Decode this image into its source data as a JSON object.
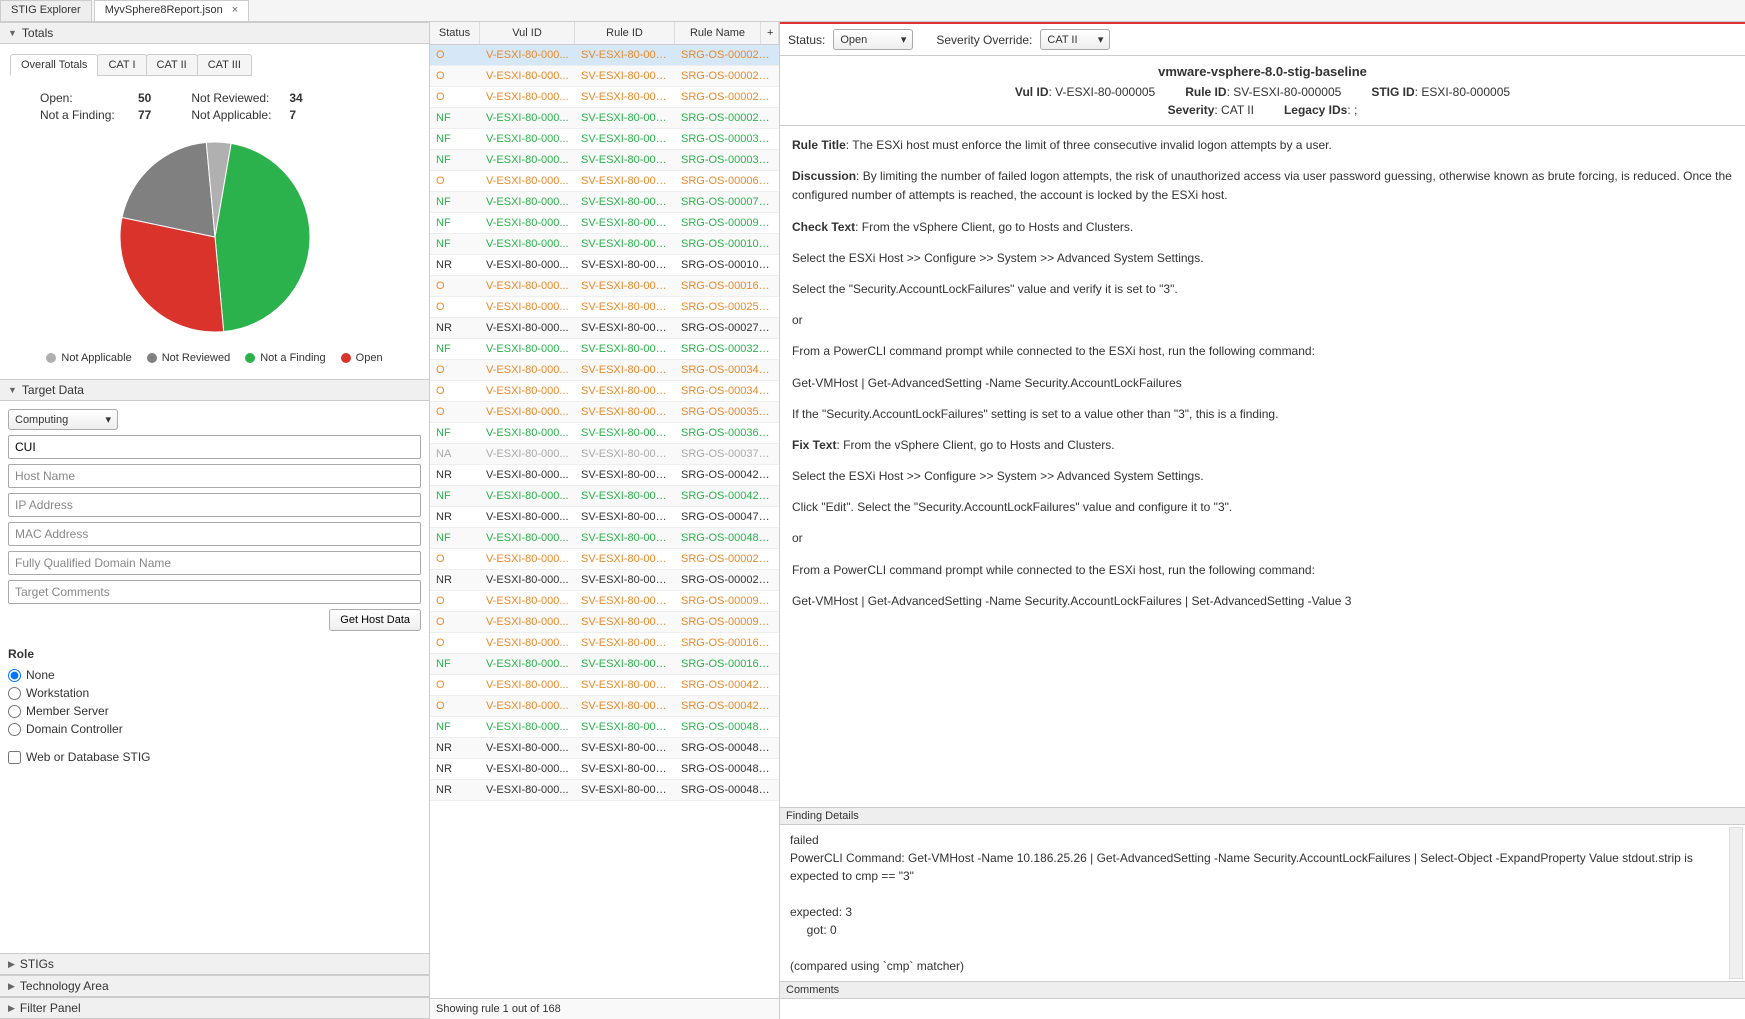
{
  "tabs": {
    "explorer": "STIG Explorer",
    "file": "MyvSphere8Report.json",
    "close_glyph": "×"
  },
  "left": {
    "totals_header": "Totals",
    "sub_tabs": [
      "Overall Totals",
      "CAT I",
      "CAT II",
      "CAT III"
    ],
    "stats": {
      "open_label": "Open:",
      "open_val": "50",
      "nf_label": "Not a Finding:",
      "nf_val": "77",
      "nr_label": "Not Reviewed:",
      "nr_val": "34",
      "na_label": "Not Applicable:",
      "na_val": "7"
    },
    "legend": {
      "na": "Not Applicable",
      "nr": "Not Reviewed",
      "nf": "Not a Finding",
      "open": "Open"
    },
    "target_header": "Target Data",
    "computing": "Computing",
    "cui": "CUI",
    "placeholders": {
      "host": "Host Name",
      "ip": "IP Address",
      "mac": "MAC Address",
      "fqdn": "Fully Qualified Domain Name",
      "comments": "Target Comments"
    },
    "get_host_btn": "Get Host Data",
    "role_title": "Role",
    "roles": {
      "none": "None",
      "ws": "Workstation",
      "ms": "Member Server",
      "dc": "Domain Controller"
    },
    "web_db": "Web or Database STIG",
    "collapsed": {
      "stigs": "STIGs",
      "tech": "Technology Area",
      "filter": "Filter Panel"
    }
  },
  "chart_data": {
    "type": "pie",
    "title": "",
    "series": [
      {
        "name": "Not a Finding",
        "value": 77,
        "color": "#2bb24c"
      },
      {
        "name": "Open",
        "value": 50,
        "color": "#d9332c"
      },
      {
        "name": "Not Reviewed",
        "value": 34,
        "color": "#808080"
      },
      {
        "name": "Not Applicable",
        "value": 7,
        "color": "#b0b0b0"
      }
    ]
  },
  "grid": {
    "headers": {
      "status": "Status",
      "vul": "Vul ID",
      "rule": "Rule ID",
      "name": "Rule Name",
      "plus": "+"
    },
    "footer": "Showing rule 1 out of 168",
    "rows": [
      {
        "s": "O",
        "v": "V-ESXI-80-000...",
        "r": "SV-ESXI-80-000...",
        "n": "SRG-OS-000021-...",
        "sel": true
      },
      {
        "s": "O",
        "v": "V-ESXI-80-000...",
        "r": "SV-ESXI-80-000...",
        "n": "SRG-OS-000023-..."
      },
      {
        "s": "O",
        "v": "V-ESXI-80-000...",
        "r": "SV-ESXI-80-000...",
        "n": "SRG-OS-000027-..."
      },
      {
        "s": "NF",
        "v": "V-ESXI-80-000...",
        "r": "SV-ESXI-80-000...",
        "n": "SRG-OS-000029-..."
      },
      {
        "s": "NF",
        "v": "V-ESXI-80-000...",
        "r": "SV-ESXI-80-000...",
        "n": "SRG-OS-000033-..."
      },
      {
        "s": "NF",
        "v": "V-ESXI-80-000...",
        "r": "SV-ESXI-80-000...",
        "n": "SRG-OS-000037-..."
      },
      {
        "s": "O",
        "v": "V-ESXI-80-000...",
        "r": "SV-ESXI-80-000...",
        "n": "SRG-OS-000069-..."
      },
      {
        "s": "NF",
        "v": "V-ESXI-80-000...",
        "r": "SV-ESXI-80-000...",
        "n": "SRG-OS-000077-..."
      },
      {
        "s": "NF",
        "v": "V-ESXI-80-000...",
        "r": "SV-ESXI-80-000...",
        "n": "SRG-OS-000095-..."
      },
      {
        "s": "NF",
        "v": "V-ESXI-80-000...",
        "r": "SV-ESXI-80-000...",
        "n": "SRG-OS-000104-..."
      },
      {
        "s": "NR",
        "v": "V-ESXI-80-000...",
        "r": "SV-ESXI-80-000...",
        "n": "SRG-OS-000107-..."
      },
      {
        "s": "O",
        "v": "V-ESXI-80-000...",
        "r": "SV-ESXI-80-000...",
        "n": "SRG-OS-000163-..."
      },
      {
        "s": "O",
        "v": "V-ESXI-80-000...",
        "r": "SV-ESXI-80-000...",
        "n": "SRG-OS-000257-..."
      },
      {
        "s": "NR",
        "v": "V-ESXI-80-000...",
        "r": "SV-ESXI-80-000...",
        "n": "SRG-OS-000278-..."
      },
      {
        "s": "NF",
        "v": "V-ESXI-80-000...",
        "r": "SV-ESXI-80-000...",
        "n": "SRG-OS-000329-..."
      },
      {
        "s": "O",
        "v": "V-ESXI-80-000...",
        "r": "SV-ESXI-80-000...",
        "n": "SRG-OS-000341-..."
      },
      {
        "s": "O",
        "v": "V-ESXI-80-000...",
        "r": "SV-ESXI-80-000...",
        "n": "SRG-OS-000342-..."
      },
      {
        "s": "O",
        "v": "V-ESXI-80-000...",
        "r": "SV-ESXI-80-000...",
        "n": "SRG-OS-000355-..."
      },
      {
        "s": "NF",
        "v": "V-ESXI-80-000...",
        "r": "SV-ESXI-80-000...",
        "n": "SRG-OS-000366-..."
      },
      {
        "s": "NA",
        "v": "V-ESXI-80-000...",
        "r": "SV-ESXI-80-000...",
        "n": "SRG-OS-000379-..."
      },
      {
        "s": "NR",
        "v": "V-ESXI-80-000...",
        "r": "SV-ESXI-80-000...",
        "n": "SRG-OS-000423-..."
      },
      {
        "s": "NF",
        "v": "V-ESXI-80-000...",
        "r": "SV-ESXI-80-000...",
        "n": "SRG-OS-000425-..."
      },
      {
        "s": "NR",
        "v": "V-ESXI-80-000...",
        "r": "SV-ESXI-80-000...",
        "n": "SRG-OS-000478-..."
      },
      {
        "s": "NF",
        "v": "V-ESXI-80-000...",
        "r": "SV-ESXI-80-000...",
        "n": "SRG-OS-000480-..."
      },
      {
        "s": "O",
        "v": "V-ESXI-80-000...",
        "r": "SV-ESXI-80-000...",
        "n": "SRG-OS-000023-..."
      },
      {
        "s": "NR",
        "v": "V-ESXI-80-000...",
        "r": "SV-ESXI-80-000...",
        "n": "SRG-OS-000023-..."
      },
      {
        "s": "O",
        "v": "V-ESXI-80-000...",
        "r": "SV-ESXI-80-000...",
        "n": "SRG-OS-000095-..."
      },
      {
        "s": "O",
        "v": "V-ESXI-80-000...",
        "r": "SV-ESXI-80-000...",
        "n": "SRG-OS-000095-..."
      },
      {
        "s": "O",
        "v": "V-ESXI-80-000...",
        "r": "SV-ESXI-80-000...",
        "n": "SRG-OS-000163-..."
      },
      {
        "s": "NF",
        "v": "V-ESXI-80-000...",
        "r": "SV-ESXI-80-000...",
        "n": "SRG-OS-000163-..."
      },
      {
        "s": "O",
        "v": "V-ESXI-80-000...",
        "r": "SV-ESXI-80-000...",
        "n": "SRG-OS-000423-..."
      },
      {
        "s": "O",
        "v": "V-ESXI-80-000...",
        "r": "SV-ESXI-80-000...",
        "n": "SRG-OS-000423-..."
      },
      {
        "s": "NF",
        "v": "V-ESXI-80-000...",
        "r": "SV-ESXI-80-000...",
        "n": "SRG-OS-000480-..."
      },
      {
        "s": "NR",
        "v": "V-ESXI-80-000...",
        "r": "SV-ESXI-80-000...",
        "n": "SRG-OS-000480-..."
      },
      {
        "s": "NR",
        "v": "V-ESXI-80-000...",
        "r": "SV-ESXI-80-000...",
        "n": "SRG-OS-000480-..."
      },
      {
        "s": "NR",
        "v": "V-ESXI-80-000...",
        "r": "SV-ESXI-80-000...",
        "n": "SRG-OS-000480-..."
      }
    ]
  },
  "right": {
    "status_lbl": "Status:",
    "status_val": "Open",
    "sev_lbl": "Severity Override:",
    "sev_val": "CAT II",
    "title": "vmware-vsphere-8.0-stig-baseline",
    "vul_id_lbl": "Vul ID",
    "vul_id": ": V-ESXI-80-000005",
    "rule_id_lbl": "Rule ID",
    "rule_id": ": SV-ESXI-80-000005",
    "stig_id_lbl": "STIG ID",
    "stig_id": ": ESXI-80-000005",
    "severity_lbl": "Severity",
    "severity": ": CAT II",
    "legacy_lbl": "Legacy IDs",
    "legacy": ": ;",
    "rule_title_lbl": "Rule Title",
    "rule_title": ": The ESXi host must enforce the limit of three consecutive invalid logon attempts by a user.",
    "discussion_lbl": "Discussion",
    "discussion": ": By limiting the number of failed logon attempts, the risk of unauthorized access via user password guessing, otherwise known as brute forcing, is reduced. Once the configured number of attempts is reached, the account is locked by the ESXi host.",
    "check_lbl": "Check Text",
    "check1": ": From the vSphere Client, go to Hosts and Clusters.",
    "check2": "Select the ESXi Host >> Configure >> System >> Advanced System Settings.",
    "check3": "Select the \"Security.AccountLockFailures\" value and verify it is set to \"3\".",
    "or": "or",
    "check4": "From a PowerCLI command prompt while connected to the ESXi host, run the following command:",
    "check5": "Get-VMHost | Get-AdvancedSetting -Name Security.AccountLockFailures",
    "check6": "If the \"Security.AccountLockFailures\" setting is set to a value other than \"3\", this is a finding.",
    "fix_lbl": "Fix Text",
    "fix1": ": From the vSphere Client, go to Hosts and Clusters.",
    "fix2": "Select the ESXi Host >> Configure >> System >> Advanced System Settings.",
    "fix3": "Click \"Edit\". Select the \"Security.AccountLockFailures\" value and configure it to \"3\".",
    "fix4": "From a PowerCLI command prompt while connected to the ESXi host, run the following command:",
    "fix5": "Get-VMHost | Get-AdvancedSetting -Name Security.AccountLockFailures | Set-AdvancedSetting -Value 3",
    "finding_header": "Finding Details",
    "finding1": "failed",
    "finding2": "PowerCLI Command: Get-VMHost -Name 10.186.25.26 | Get-AdvancedSetting -Name Security.AccountLockFailures | Select-Object -ExpandProperty Value stdout.strip is expected to cmp == \"3\"",
    "finding3": "expected: 3",
    "finding4": "     got: 0",
    "finding5": "(compared using `cmp` matcher)",
    "comments_header": "Comments"
  }
}
